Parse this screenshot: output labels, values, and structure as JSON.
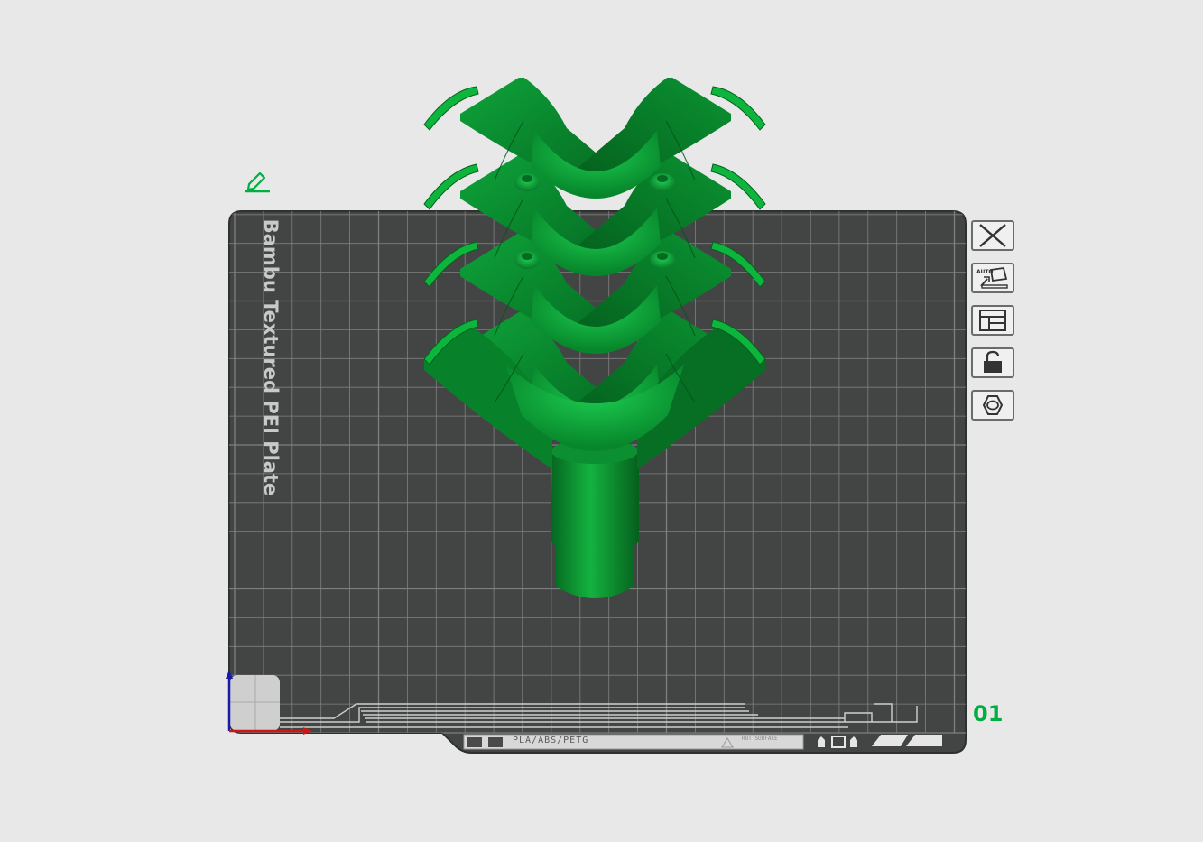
{
  "plate": {
    "name": "Bambu Textured PEI Plate",
    "number": "01",
    "filament_types": "PLA/ABS/PETG",
    "hot_surface_warning": "HOT SURFACE"
  },
  "toolbar": {
    "buttons": [
      {
        "name": "close",
        "icon": "close-icon"
      },
      {
        "name": "auto-orient",
        "icon": "auto-orient-icon"
      },
      {
        "name": "arrange",
        "icon": "arrange-layout-icon"
      },
      {
        "name": "lock",
        "icon": "unlock-icon"
      },
      {
        "name": "plate-settings",
        "icon": "hexagon-settings-icon"
      }
    ]
  },
  "colors": {
    "background": "#e8e8e8",
    "plate": "#434545",
    "grid": "#878787",
    "model": "#0a9a32",
    "accent": "#00ae42"
  }
}
